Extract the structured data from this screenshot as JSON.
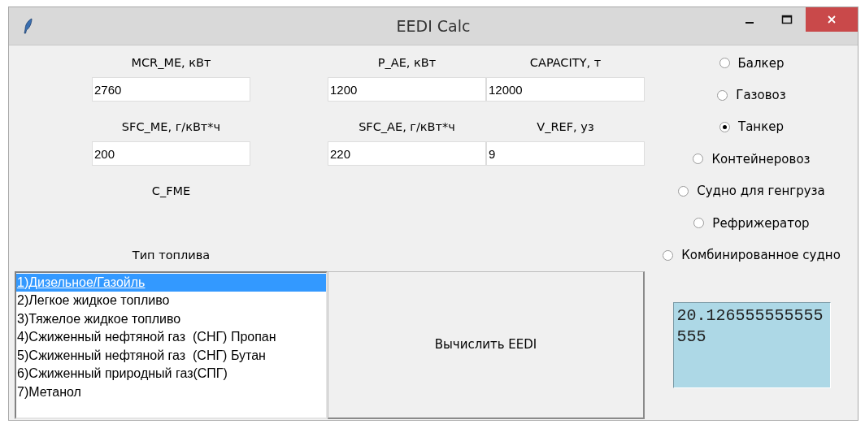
{
  "window": {
    "title": "EEDI Calc"
  },
  "fields": [
    {
      "label": "MCR_ME, кВт",
      "value": "2760"
    },
    {
      "label": "P_AE, кВт",
      "value": "1200"
    },
    {
      "label": "CAPACITY, т",
      "value": "12000"
    },
    {
      "label": "SFC_ME, г/кВт*ч",
      "value": "200"
    },
    {
      "label": "SFC_AE, г/кВт*ч",
      "value": "220"
    },
    {
      "label": "V_REF, уз",
      "value": "9"
    }
  ],
  "c_fme_label": "C_FME",
  "fuel_label": "Тип топлива",
  "fuel_types": [
    {
      "label": "1)Дизельное/Газойль",
      "selected": true
    },
    {
      "label": "2)Легкое жидкое топливо",
      "selected": false
    },
    {
      "label": "3)Тяжелое жидкое топливо",
      "selected": false
    },
    {
      "label": "4)Сжиженный нефтяной газ  (СНГ) Пропан",
      "selected": false
    },
    {
      "label": "5)Сжиженный нефтяной газ  (СНГ) Бутан",
      "selected": false
    },
    {
      "label": "6)Сжиженный природный газ(СПГ)",
      "selected": false
    },
    {
      "label": "7)Метанол",
      "selected": false
    }
  ],
  "calculate_button": "Вычислить EEDI",
  "result": "20.126555555555555",
  "ship_types": [
    {
      "label": "Балкер",
      "selected": false
    },
    {
      "label": "Газовоз",
      "selected": false
    },
    {
      "label": "Танкер",
      "selected": true
    },
    {
      "label": "Контейнеровоз",
      "selected": false
    },
    {
      "label": "Судно для генгруза",
      "selected": false
    },
    {
      "label": "Рефрижератор",
      "selected": false
    },
    {
      "label": "Комбинированное судно",
      "selected": false
    }
  ]
}
